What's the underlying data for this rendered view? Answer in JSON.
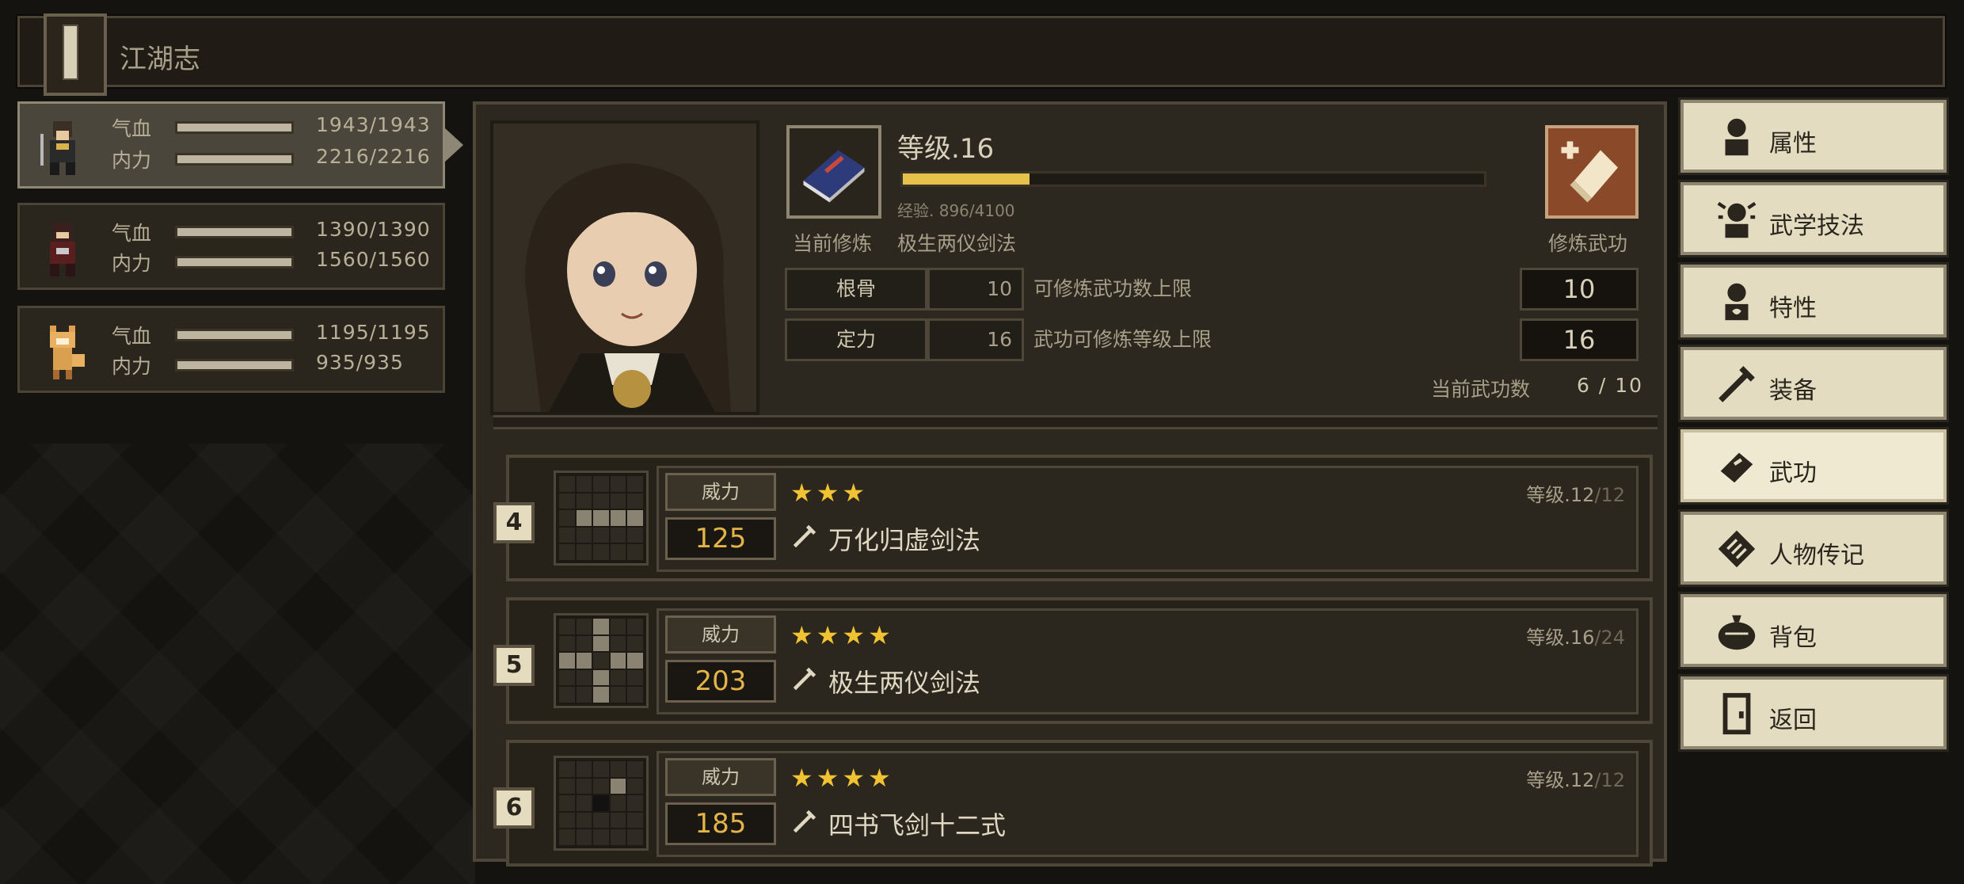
{
  "header": {
    "title": "江湖志"
  },
  "party": [
    {
      "hp_label": "气血",
      "hp_value": "1943/1943",
      "mp_label": "内力",
      "mp_value": "2216/2216",
      "selected": true
    },
    {
      "hp_label": "气血",
      "hp_value": "1390/1390",
      "mp_label": "内力",
      "mp_value": "1560/1560",
      "selected": false
    },
    {
      "hp_label": "气血",
      "hp_value": "1195/1195",
      "mp_label": "内力",
      "mp_value": "935/935",
      "selected": false
    }
  ],
  "character": {
    "level": "等级.16",
    "xp_text": "经验. 896/4100",
    "xp_progress": 0.218,
    "current_label": "当前修炼",
    "current_skill": "极生两仪剑法",
    "train_label": "修炼武功",
    "stats": [
      {
        "key": "根骨",
        "value": "10",
        "desc": "可修炼武功数上限",
        "max": "10"
      },
      {
        "key": "定力",
        "value": "16",
        "desc": "武功可修炼等级上限",
        "max": "16"
      }
    ],
    "count_label": "当前武功数",
    "count_value": "6 / 10"
  },
  "skills": [
    {
      "index": "4",
      "power_label": "威力",
      "power": "125",
      "stars": "★★★",
      "name": "万化归虚剑法",
      "level_prefix": "等级.12",
      "level_max": "/12"
    },
    {
      "index": "5",
      "power_label": "威力",
      "power": "203",
      "stars": "★★★★",
      "name": "极生两仪剑法",
      "level_prefix": "等级.16",
      "level_max": "/24"
    },
    {
      "index": "6",
      "power_label": "威力",
      "power": "185",
      "stars": "★★★★",
      "name": "四书飞剑十二式",
      "level_prefix": "等级.12",
      "level_max": "/12"
    }
  ],
  "menu": [
    {
      "label": "属性",
      "icon": "attribute-icon"
    },
    {
      "label": "武学技法",
      "icon": "martial-technique-icon"
    },
    {
      "label": "特性",
      "icon": "trait-icon"
    },
    {
      "label": "装备",
      "icon": "equipment-icon"
    },
    {
      "label": "武功",
      "icon": "martial-arts-book-icon",
      "selected": true
    },
    {
      "label": "人物传记",
      "icon": "biography-icon"
    },
    {
      "label": "背包",
      "icon": "bag-icon"
    },
    {
      "label": "返回",
      "icon": "door-icon"
    }
  ],
  "colors": {
    "accent": "#e7c24a",
    "star": "#f1c232",
    "power": "#e3b548",
    "menu_bg": "#e4dcc1"
  }
}
